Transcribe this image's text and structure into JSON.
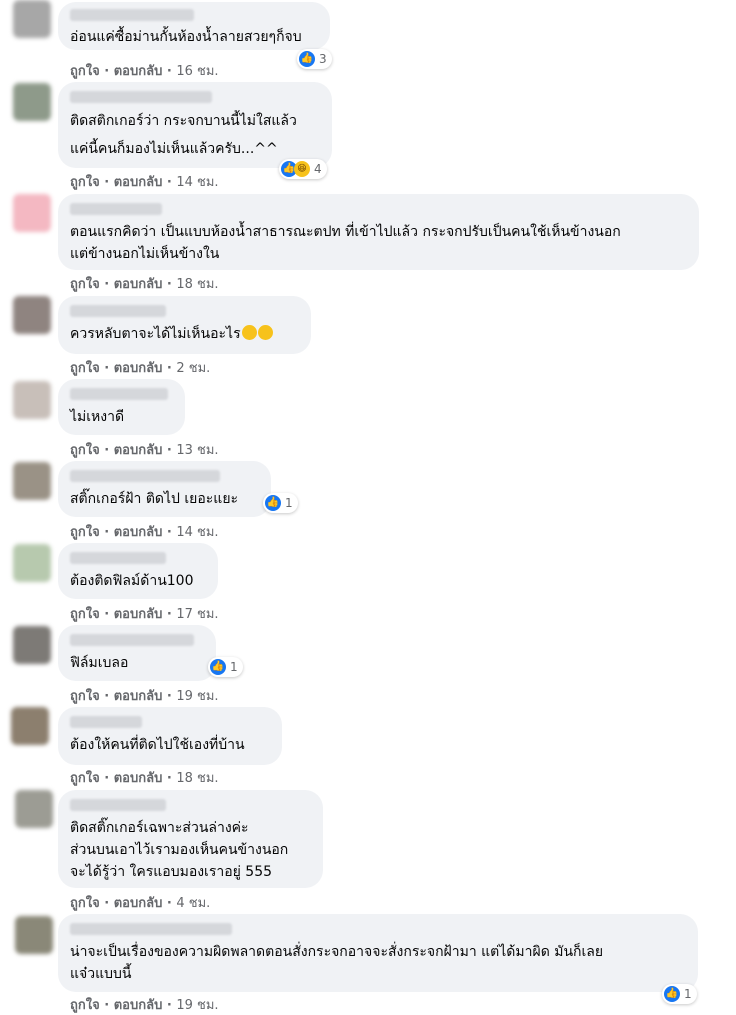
{
  "ui": {
    "like": "ถูกใจ",
    "reply": "ตอบกลับ",
    "sep": "·"
  },
  "comments": [
    {
      "text": "อ่อนแค่ซื้อม่านกั้นห้องน้ำลายสวยๆก็จบ",
      "time": "16 ชม.",
      "reactions": "3"
    },
    {
      "text": "ติดสติกเกอร์ว่า กระจกบานนี้ไม่ใสแล้ว\nแค่นี้คนก็มองไม่เห็นแล้วครับ...^^",
      "time": "14 ชม.",
      "reactions": "4"
    },
    {
      "text": "ตอนแรกคิดว่า เป็นแบบห้องน้ำสาธารณะตปท ที่เข้าไปแล้ว กระจกปรับเป็นคนใช้เห็นข้างนอก\nแต่ข้างนอกไม่เห็นข้างใน",
      "time": "18 ชม."
    },
    {
      "text": "ควรหลับตาจะได้ไม่เห็นอะไร",
      "time": "2 ชม."
    },
    {
      "text": "ไม่เหงาดี",
      "time": "13 ชม."
    },
    {
      "text": "สติ๊กเกอร์ฝ้า ติดไป เยอะแยะ",
      "time": "14 ชม.",
      "reactions": "1"
    },
    {
      "text": "ต้องติดฟิลม์ด้าน100",
      "time": "17 ชม."
    },
    {
      "text": "ฟิล์มเบลอ",
      "time": "19 ชม.",
      "reactions": "1"
    },
    {
      "text": "ต้องให้คนที่ติดไปใช้เองที่บ้าน",
      "time": "18 ชม."
    },
    {
      "text": "ติดสติ๊กเกอร์เฉพาะส่วนล่างค่ะ\nส่วนบนเอาไว้เรามองเห็นคนข้างนอก\nจะได้รู้ว่า ใครแอบมองเราอยู่ 555",
      "time": "4 ชม."
    },
    {
      "text": "น่าจะเป็นเรื่องของความผิดพลาดตอนสั่งกระจกอาจจะสั่งกระจกฝ้ามา แต่ได้มาผิด มันก็เลย\nแจ๋วแบบนี้",
      "time": "19 ชม.",
      "reactions": "1"
    }
  ]
}
